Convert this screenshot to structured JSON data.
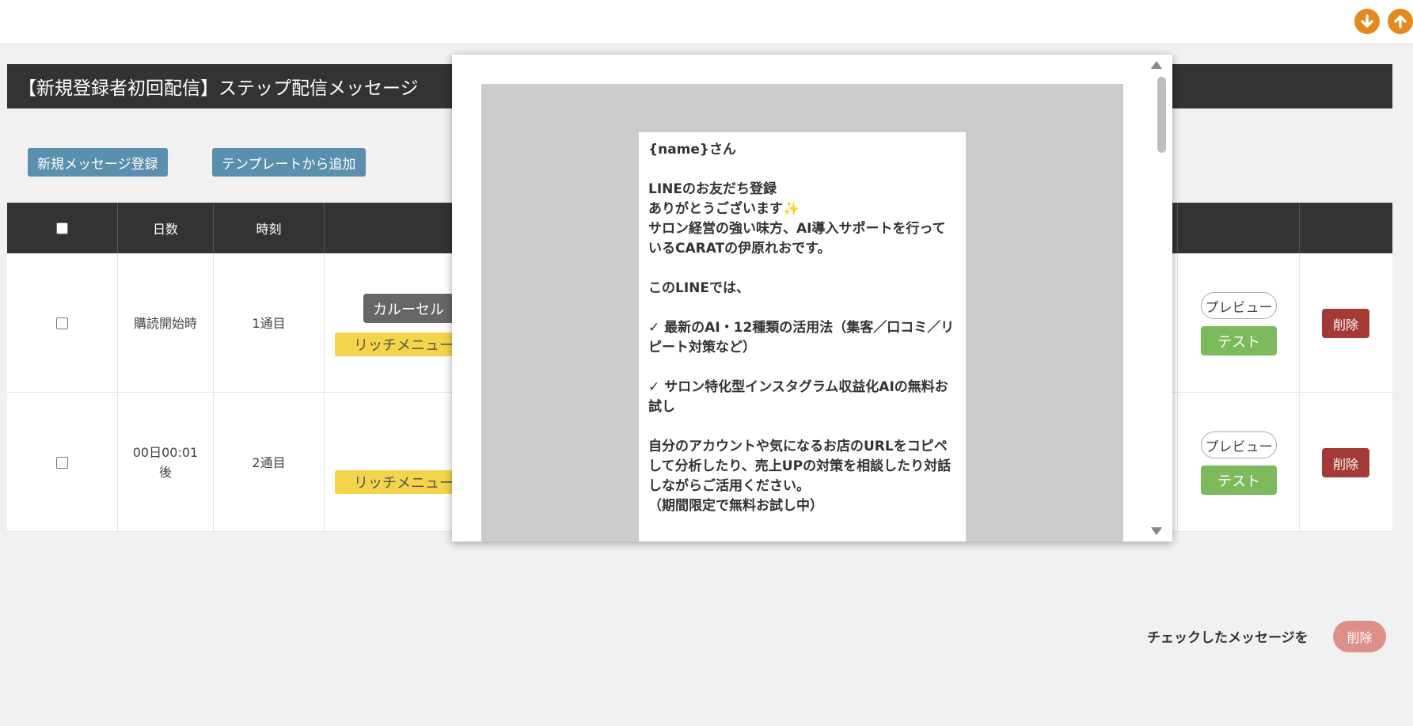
{
  "panel": {
    "title": "【新規登録者初回配信】ステップ配信メッセージ",
    "new_message_label": "新規メッセージ登録",
    "add_from_template_label": "テンプレートから追加"
  },
  "table": {
    "headers": {
      "days": "日数",
      "time": "時刻"
    },
    "rows": [
      {
        "days": "購読開始時",
        "time": "1通目",
        "tag_dark": "カルーセル",
        "tag_yellow": "リッチメニュー",
        "preview": "プレビュー",
        "test": "テスト",
        "delete": "削除"
      },
      {
        "days": "00日00:01\n後",
        "time": "2通目",
        "tag_yellow": "リッチメニュー",
        "preview": "プレビュー",
        "test": "テスト",
        "delete": "削除"
      }
    ]
  },
  "footer": {
    "checked_label": "チェックしたメッセージを",
    "delete_label": "削除"
  },
  "modal": {
    "message": "{name}さん\n\nLINEのお友だち登録\nありがとうございます✨\nサロン経営の強い味方、AI導入サポートを行っているCARATの伊原れおです。\n\nこのLINEでは、\n\n✓ 最新のAI・12種類の活用法（集客／口コミ／リピート対策など）\n\n✓ サロン特化型インスタグラム収益化AIの無料お試し\n\n自分のアカウントや気になるお店のURLをコピペして分析したり、売上UPの対策を相談したり対話しながらご活用ください。\n（期間限定で無料お試し中）"
  },
  "colors": {
    "header_dark": "#333333",
    "accent_orange": "#e3891f",
    "button_blue": "#5b8fae",
    "tag_yellow": "#f3d44a",
    "test_green": "#7dba5c",
    "delete_red": "#a33a36"
  },
  "icons": {
    "scroll_down": "arrow-down-circle-icon",
    "scroll_up": "arrow-up-circle-icon"
  }
}
